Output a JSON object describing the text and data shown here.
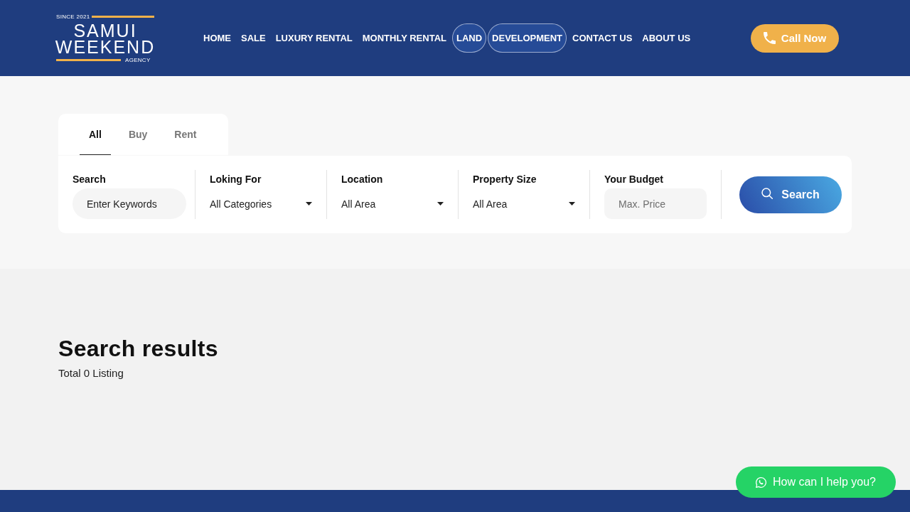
{
  "header": {
    "logo": {
      "since": "SINCE 2021",
      "line_1": "SAMUI",
      "line_2": "WEEKEND",
      "tagline": "AGENCY"
    },
    "nav": [
      {
        "label": "HOME",
        "highlighted": false
      },
      {
        "label": "SALE",
        "highlighted": false
      },
      {
        "label": "LUXURY RENTAL",
        "highlighted": false
      },
      {
        "label": "MONTHLY RENTAL",
        "highlighted": false
      },
      {
        "label": "LAND",
        "highlighted": true
      },
      {
        "label": "DEVELOPMENT",
        "highlighted": true
      },
      {
        "label": "CONTACT US",
        "highlighted": false
      },
      {
        "label": "ABOUT US",
        "highlighted": false
      }
    ],
    "call_button": {
      "label": "Call Now"
    }
  },
  "search_panel": {
    "tabs": [
      {
        "label": "All",
        "selected": true
      },
      {
        "label": "Buy",
        "selected": false
      },
      {
        "label": "Rent",
        "selected": false
      }
    ],
    "fields": [
      {
        "kind": "keyword",
        "label": "Search",
        "placeholder": "Enter Keywords"
      },
      {
        "kind": "select",
        "label": "Loking For",
        "value": "All Categories"
      },
      {
        "kind": "select",
        "label": "Location",
        "value": "All Area"
      },
      {
        "kind": "select",
        "label": "Property Size",
        "value": "All Area"
      },
      {
        "kind": "budget",
        "label": "Your Budget",
        "placeholder": "Max. Price"
      }
    ],
    "search_button": {
      "label": "Search"
    }
  },
  "results": {
    "title": "Search results",
    "summary": "Total 0 Listing"
  },
  "chat_button": {
    "label": "How can I help you?"
  }
}
